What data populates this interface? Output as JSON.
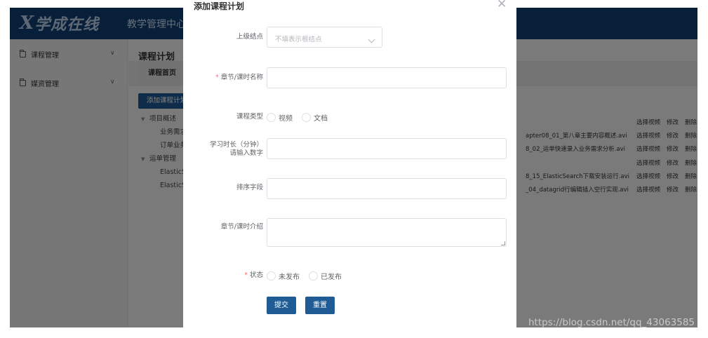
{
  "header": {
    "logo_mark": "X",
    "logo_text": "学成在线",
    "center_name": "教学管理中心"
  },
  "sidebar": {
    "items": [
      {
        "label": "课程管理"
      },
      {
        "label": "媒资管理"
      }
    ]
  },
  "main": {
    "title": "课程计划",
    "tab_home": "课程首页",
    "add_button": "添加课程计划",
    "tree": [
      {
        "label": "项目概述",
        "level": 0
      },
      {
        "label": "业务需求分",
        "level": 1
      },
      {
        "label": "订单业务分",
        "level": 1
      },
      {
        "label": "运单管理",
        "level": 0
      },
      {
        "label": "ElasticSea",
        "level": 1
      },
      {
        "label": "ElasticSea",
        "level": 1
      }
    ],
    "files": [
      "",
      "apter08_01_第八章主要内容概述.avi",
      "8_02_运单快速录入业务需求分析.avi",
      "",
      "8_15_ElasticSearch下载安装运行.avi",
      "_04_datagrid行编辑插入空行实现.avi"
    ],
    "ops": {
      "select_video": "选择视频",
      "edit": "修改",
      "delete": "删除"
    }
  },
  "dialog": {
    "title": "添加课程计划",
    "fields": {
      "parent": {
        "label": "上级结点",
        "placeholder": "不填表示根结点"
      },
      "name": {
        "label": "章节/课时名称",
        "value": ""
      },
      "type": {
        "label": "课程类型",
        "options": [
          "视频",
          "文档"
        ]
      },
      "duration": {
        "label_line1": "学习时长（分钟）",
        "label_line2": "请输入数字",
        "value": ""
      },
      "order": {
        "label": "排序字段",
        "value": ""
      },
      "description": {
        "label": "章节/课时介绍",
        "value": ""
      },
      "status": {
        "label": "状态",
        "options": [
          "未发布",
          "已发布"
        ]
      }
    },
    "submit": "提交",
    "reset": "重置"
  },
  "watermark": "https://blog.csdn.net/qq_43063585"
}
